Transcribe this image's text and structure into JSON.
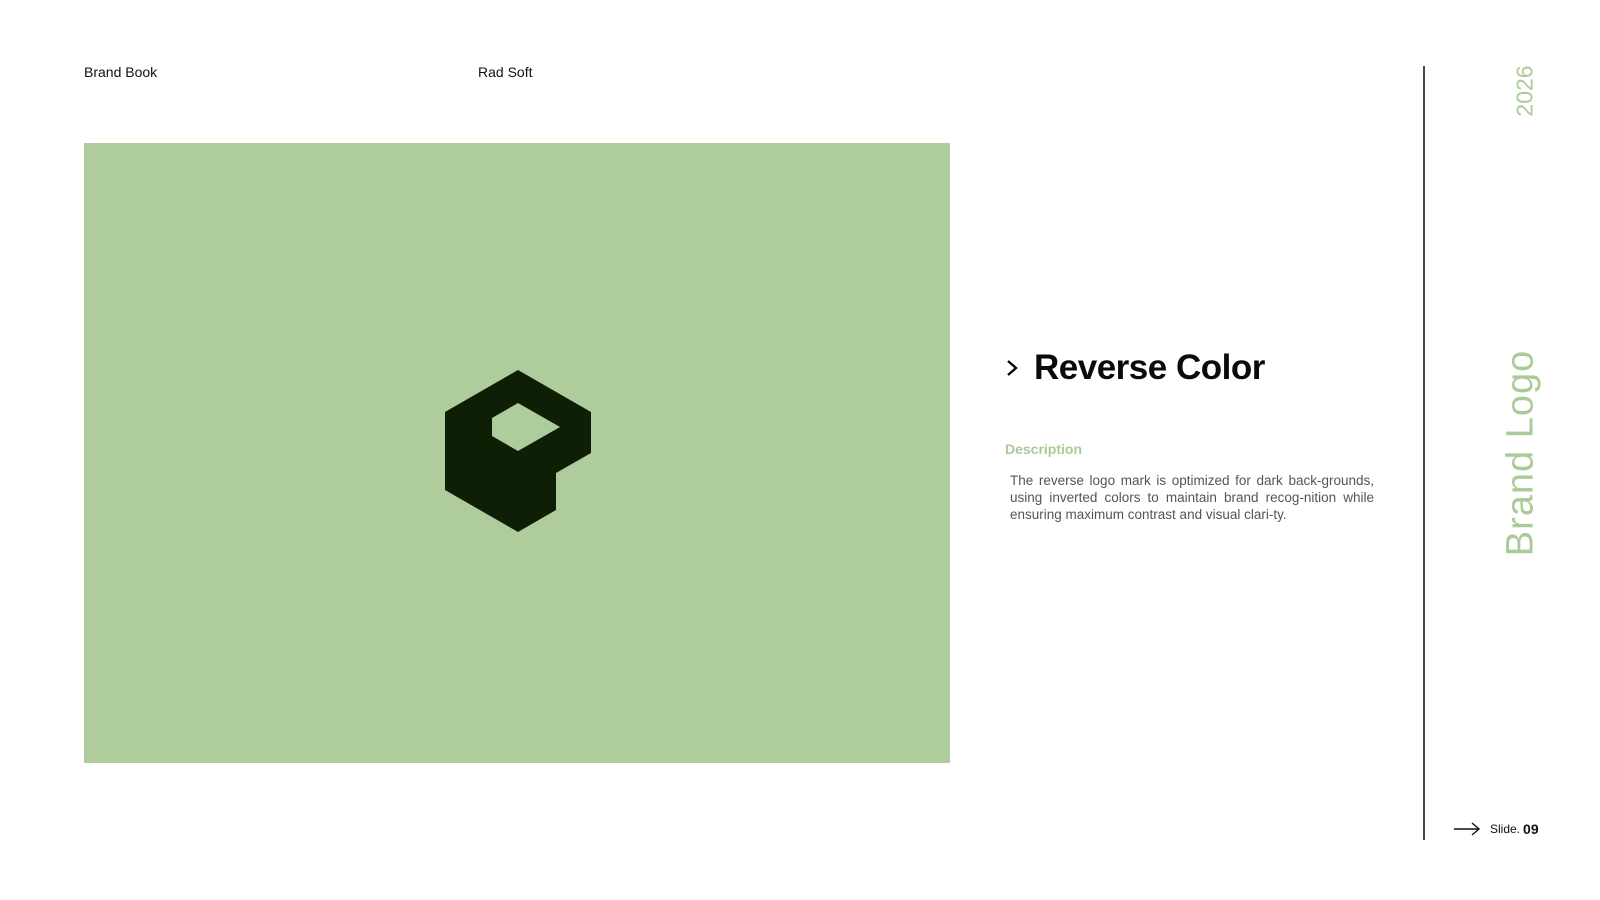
{
  "header": {
    "left": "Brand Book",
    "middle": "Rad Soft"
  },
  "logo_panel": {
    "background": "#afcd9c",
    "mark_color": "#0f1f05",
    "icon": "rad-soft-hexagon-logo-icon"
  },
  "content": {
    "title": "Reverse Color",
    "description_label": "Description",
    "description": "The reverse logo mark is optimized for dark back-grounds, using inverted colors to maintain brand recog-nition while ensuring maximum contrast and visual clari-ty."
  },
  "sidebar": {
    "year": "2026",
    "section": "Brand Logo",
    "accent": "#a9cb98",
    "rule_color": "#3b4f33"
  },
  "footer": {
    "slide_label": "Slide.",
    "slide_number": "09"
  }
}
